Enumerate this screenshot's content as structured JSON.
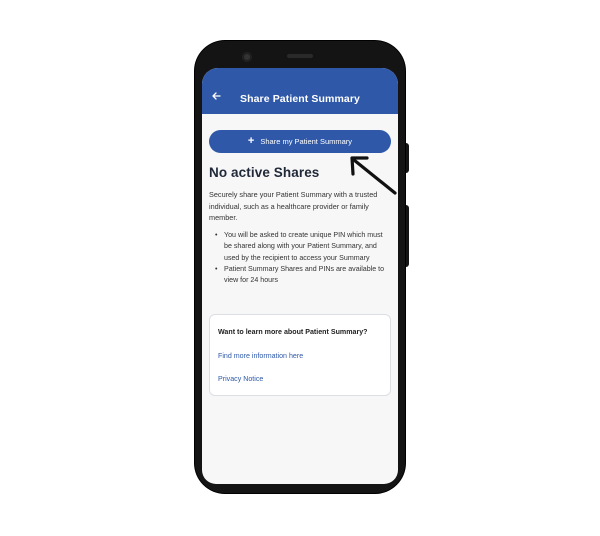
{
  "header": {
    "title": "Share Patient Summary",
    "back_icon": "arrow-left-icon"
  },
  "share_button": {
    "label": "Share my Patient Summary",
    "icon": "plus-icon"
  },
  "empty_state": {
    "heading": "No active Shares",
    "intro": "Securely share your Patient Summary with a trusted individual, such as a healthcare provider or family member.",
    "bullets": [
      "You will be asked to create unique PIN which must be shared along with your Patient Summary, and used by the recipient to access your Summary",
      "Patient Summary Shares and PINs are available to view for 24 hours"
    ]
  },
  "info_card": {
    "title": "Want to learn more about Patient Summary?",
    "link_more": "Find more information here",
    "link_privacy": "Privacy Notice"
  },
  "colors": {
    "brand": "#2f59a8",
    "background": "#f7f7f8"
  },
  "annotation": {
    "icon": "pointer-arrow-icon"
  }
}
